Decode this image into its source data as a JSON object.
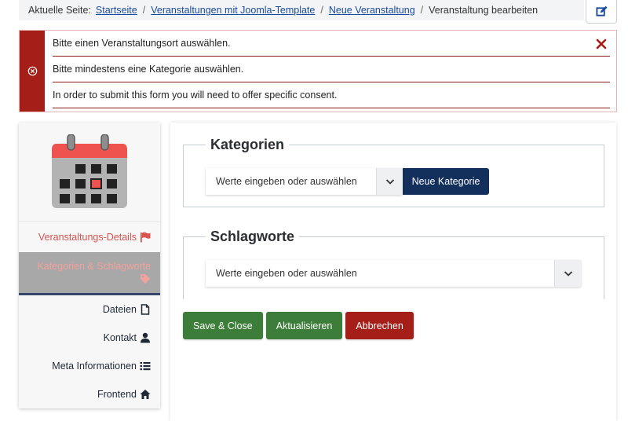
{
  "breadcrumb": {
    "label": "Aktuelle Seite:",
    "items": [
      "Startseite",
      "Veranstaltungen mit Joomla-Template",
      "Neue Veranstaltung"
    ],
    "current": "Veranstaltung bearbeiten",
    "separator": "/"
  },
  "alert": {
    "messages": [
      "Bitte einen Veranstaltungsort auswählen.",
      "Bitte mindestens eine Kategorie auswählen.",
      "In order to submit this form you will need to offer specific consent."
    ]
  },
  "sidebar": {
    "items": [
      {
        "label": "Veranstaltungs-Details",
        "icon": "flag-icon"
      },
      {
        "label": "Kategorien & Schlagworte",
        "icon": "tag-icon"
      },
      {
        "label": "Dateien",
        "icon": "file-icon"
      },
      {
        "label": "Kontakt",
        "icon": "user-icon"
      },
      {
        "label": "Meta Informationen",
        "icon": "list-icon"
      },
      {
        "label": "Frontend",
        "icon": "home-icon"
      }
    ]
  },
  "kategorien": {
    "legend": "Kategorien",
    "placeholder": "Werte eingeben oder auswählen",
    "new_button": "Neue Kategorie"
  },
  "schlagworte": {
    "legend": "Schlagworte",
    "placeholder": "Werte eingeben oder auswählen"
  },
  "actions": {
    "save_close": "Save & Close",
    "update": "Aktualisieren",
    "cancel": "Abbrechen"
  },
  "colors": {
    "alert_red": "#a51f18",
    "primary_blue": "#132f5c",
    "success_green": "#3d7d3a",
    "calendar_red": "#ef5350",
    "calendar_gray": "#b3b3b3"
  }
}
